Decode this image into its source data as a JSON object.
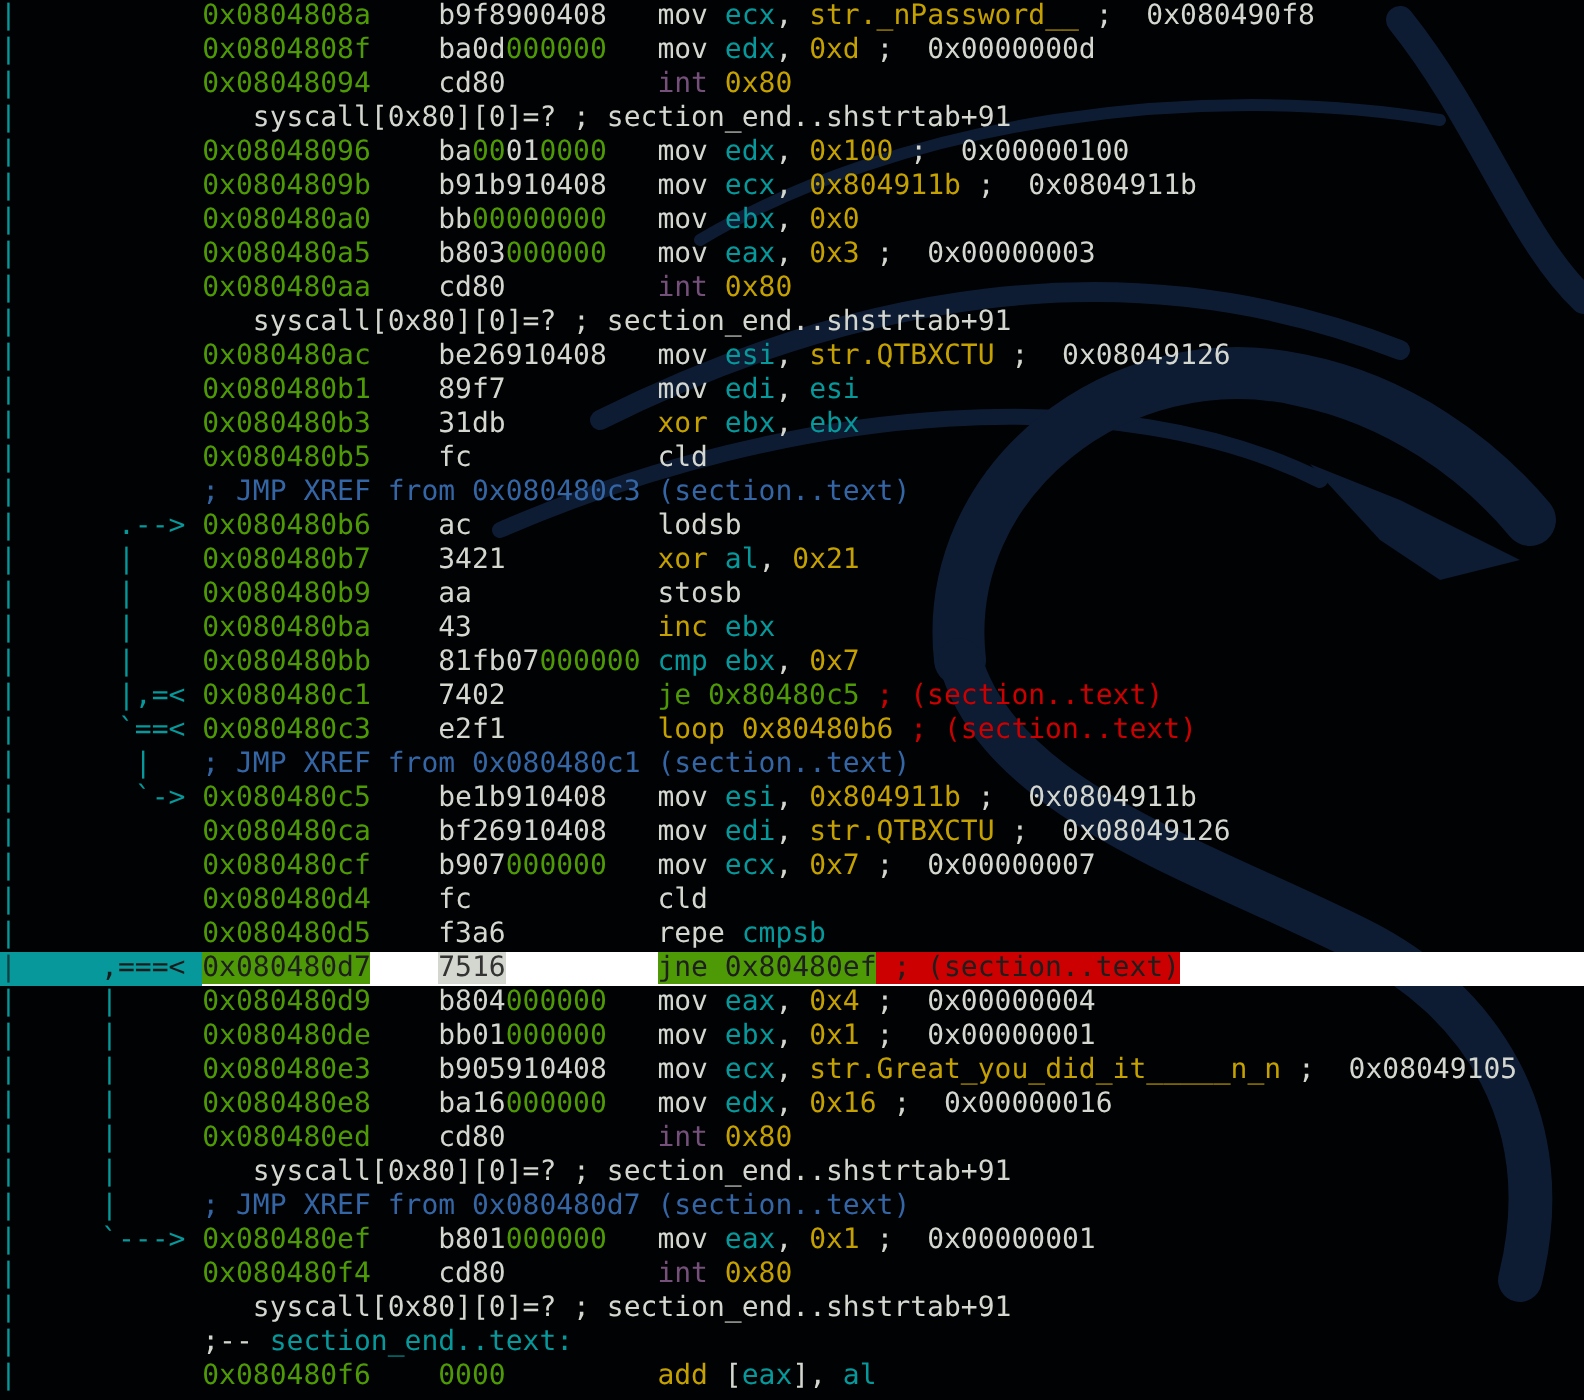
{
  "lines": [
    {
      "kind": "instr",
      "gutter": "|",
      "selected": false,
      "address": "0x0804808a",
      "bytes": [
        {
          "text": "b9f8900408",
          "kind": "hex"
        }
      ],
      "tokens": [
        {
          "text": "mov",
          "kind": "mn"
        },
        {
          "text": " ecx",
          "kind": "reg"
        },
        {
          "text": ",",
          "kind": "punct"
        },
        {
          "text": " str._nPassword__",
          "kind": "str"
        },
        {
          "text": " ;  0x080490f8",
          "kind": "comment"
        }
      ]
    },
    {
      "kind": "instr",
      "gutter": "|",
      "selected": false,
      "address": "0x0804808f",
      "bytes": [
        {
          "text": "ba0d",
          "kind": "hex"
        },
        {
          "text": "000000",
          "kind": "zero"
        }
      ],
      "tokens": [
        {
          "text": "mov",
          "kind": "mn"
        },
        {
          "text": " edx",
          "kind": "reg"
        },
        {
          "text": ",",
          "kind": "punct"
        },
        {
          "text": " 0xd",
          "kind": "num"
        },
        {
          "text": " ;  0x0000000d",
          "kind": "comment"
        }
      ]
    },
    {
      "kind": "instr",
      "gutter": "|",
      "selected": false,
      "address": "0x08048094",
      "bytes": [
        {
          "text": "cd80",
          "kind": "hex"
        }
      ],
      "tokens": [
        {
          "text": "int",
          "kind": "trap"
        },
        {
          "text": " 0x80",
          "kind": "num"
        }
      ]
    },
    {
      "kind": "syscall",
      "gutter": "|",
      "text": "syscall[0x80][0]=? ; section_end..shstrtab+91"
    },
    {
      "kind": "instr",
      "gutter": "|",
      "selected": false,
      "address": "0x08048096",
      "bytes": [
        {
          "text": "ba",
          "kind": "hex"
        },
        {
          "text": "00",
          "kind": "zero"
        },
        {
          "text": "01",
          "kind": "hex"
        },
        {
          "text": "0000",
          "kind": "zero"
        }
      ],
      "tokens": [
        {
          "text": "mov",
          "kind": "mn"
        },
        {
          "text": " edx",
          "kind": "reg"
        },
        {
          "text": ",",
          "kind": "punct"
        },
        {
          "text": " 0x100",
          "kind": "num"
        },
        {
          "text": " ;  0x00000100",
          "kind": "comment"
        }
      ]
    },
    {
      "kind": "instr",
      "gutter": "|",
      "selected": false,
      "address": "0x0804809b",
      "bytes": [
        {
          "text": "b91b910408",
          "kind": "hex"
        }
      ],
      "tokens": [
        {
          "text": "mov",
          "kind": "mn"
        },
        {
          "text": " ecx",
          "kind": "reg"
        },
        {
          "text": ",",
          "kind": "punct"
        },
        {
          "text": " 0x804911b",
          "kind": "num"
        },
        {
          "text": " ;  0x0804911b",
          "kind": "comment"
        }
      ]
    },
    {
      "kind": "instr",
      "gutter": "|",
      "selected": false,
      "address": "0x080480a0",
      "bytes": [
        {
          "text": "bb",
          "kind": "hex"
        },
        {
          "text": "00000000",
          "kind": "zero"
        }
      ],
      "tokens": [
        {
          "text": "mov",
          "kind": "mn"
        },
        {
          "text": " ebx",
          "kind": "reg"
        },
        {
          "text": ",",
          "kind": "punct"
        },
        {
          "text": " 0x0",
          "kind": "num"
        }
      ]
    },
    {
      "kind": "instr",
      "gutter": "|",
      "selected": false,
      "address": "0x080480a5",
      "bytes": [
        {
          "text": "b803",
          "kind": "hex"
        },
        {
          "text": "000000",
          "kind": "zero"
        }
      ],
      "tokens": [
        {
          "text": "mov",
          "kind": "mn"
        },
        {
          "text": " eax",
          "kind": "reg"
        },
        {
          "text": ",",
          "kind": "punct"
        },
        {
          "text": " 0x3",
          "kind": "num"
        },
        {
          "text": " ;  0x00000003",
          "kind": "comment"
        }
      ]
    },
    {
      "kind": "instr",
      "gutter": "|",
      "selected": false,
      "address": "0x080480aa",
      "bytes": [
        {
          "text": "cd80",
          "kind": "hex"
        }
      ],
      "tokens": [
        {
          "text": "int",
          "kind": "trap"
        },
        {
          "text": " 0x80",
          "kind": "num"
        }
      ]
    },
    {
      "kind": "syscall",
      "gutter": "|",
      "text": "syscall[0x80][0]=? ; section_end..shstrtab+91"
    },
    {
      "kind": "instr",
      "gutter": "|",
      "selected": false,
      "address": "0x080480ac",
      "bytes": [
        {
          "text": "be26910408",
          "kind": "hex"
        }
      ],
      "tokens": [
        {
          "text": "mov",
          "kind": "mn"
        },
        {
          "text": " esi",
          "kind": "reg"
        },
        {
          "text": ",",
          "kind": "punct"
        },
        {
          "text": " str.QTBXCTU",
          "kind": "str"
        },
        {
          "text": " ;  0x08049126",
          "kind": "comment"
        }
      ]
    },
    {
      "kind": "instr",
      "gutter": "|",
      "selected": false,
      "address": "0x080480b1",
      "bytes": [
        {
          "text": "89f7",
          "kind": "hex"
        }
      ],
      "tokens": [
        {
          "text": "mov",
          "kind": "mn"
        },
        {
          "text": " edi",
          "kind": "reg"
        },
        {
          "text": ",",
          "kind": "punct"
        },
        {
          "text": " esi",
          "kind": "reg"
        }
      ]
    },
    {
      "kind": "instr",
      "gutter": "|",
      "selected": false,
      "address": "0x080480b3",
      "bytes": [
        {
          "text": "31db",
          "kind": "hex"
        }
      ],
      "tokens": [
        {
          "text": "xor",
          "kind": "arith"
        },
        {
          "text": " ebx",
          "kind": "reg"
        },
        {
          "text": ",",
          "kind": "punct"
        },
        {
          "text": " ebx",
          "kind": "reg"
        }
      ]
    },
    {
      "kind": "instr",
      "gutter": "|",
      "selected": false,
      "address": "0x080480b5",
      "bytes": [
        {
          "text": "fc",
          "kind": "hex"
        }
      ],
      "tokens": [
        {
          "text": "cld",
          "kind": "mn"
        }
      ]
    },
    {
      "kind": "xref",
      "gutter": "|",
      "text": "; JMP XREF from 0x080480c3 (section..text)"
    },
    {
      "kind": "instr",
      "gutter": "|",
      "selected": false,
      "flow": ".-->",
      "address": "0x080480b6",
      "bytes": [
        {
          "text": "ac",
          "kind": "hex"
        }
      ],
      "tokens": [
        {
          "text": "lodsb",
          "kind": "mn"
        }
      ]
    },
    {
      "kind": "instr",
      "gutter": "|",
      "selected": false,
      "flow": "|   ",
      "address": "0x080480b7",
      "bytes": [
        {
          "text": "3421",
          "kind": "hex"
        }
      ],
      "tokens": [
        {
          "text": "xor",
          "kind": "arith"
        },
        {
          "text": " al",
          "kind": "reg"
        },
        {
          "text": ",",
          "kind": "punct"
        },
        {
          "text": " 0x21",
          "kind": "num"
        }
      ]
    },
    {
      "kind": "instr",
      "gutter": "|",
      "selected": false,
      "flow": "|   ",
      "address": "0x080480b9",
      "bytes": [
        {
          "text": "aa",
          "kind": "hex"
        }
      ],
      "tokens": [
        {
          "text": "stosb",
          "kind": "mn"
        }
      ]
    },
    {
      "kind": "instr",
      "gutter": "|",
      "selected": false,
      "flow": "|   ",
      "address": "0x080480ba",
      "bytes": [
        {
          "text": "43",
          "kind": "hex"
        }
      ],
      "tokens": [
        {
          "text": "inc",
          "kind": "arith"
        },
        {
          "text": " ebx",
          "kind": "reg"
        }
      ]
    },
    {
      "kind": "instr",
      "gutter": "|",
      "selected": false,
      "flow": "|   ",
      "address": "0x080480bb",
      "bytes": [
        {
          "text": "81fb07",
          "kind": "hex"
        },
        {
          "text": "000000",
          "kind": "zero"
        }
      ],
      "tokens": [
        {
          "text": "cmp",
          "kind": "cmp"
        },
        {
          "text": " ebx",
          "kind": "reg"
        },
        {
          "text": ",",
          "kind": "punct"
        },
        {
          "text": " 0x7",
          "kind": "num"
        }
      ]
    },
    {
      "kind": "instr",
      "gutter": "|",
      "selected": false,
      "flow": "|,=<",
      "address": "0x080480c1",
      "bytes": [
        {
          "text": "7402",
          "kind": "hex"
        }
      ],
      "tokens": [
        {
          "text": "je 0x80480c5",
          "kind": "jump"
        },
        {
          "text": " ; (section..text)",
          "kind": "ref"
        }
      ]
    },
    {
      "kind": "instr",
      "gutter": "|",
      "selected": false,
      "flow": "`==<",
      "address": "0x080480c3",
      "bytes": [
        {
          "text": "e2f1",
          "kind": "hex"
        }
      ],
      "tokens": [
        {
          "text": "loop",
          "kind": "arith"
        },
        {
          "text": " 0x80480b6",
          "kind": "num"
        },
        {
          "text": " ; (section..text)",
          "kind": "ref"
        }
      ]
    },
    {
      "kind": "xref",
      "gutter": "|",
      "flow": "|  ",
      "text": "; JMP XREF from 0x080480c1 (section..text)"
    },
    {
      "kind": "instr",
      "gutter": "|",
      "selected": false,
      "flow": "`->",
      "address": "0x080480c5",
      "bytes": [
        {
          "text": "be1b910408",
          "kind": "hex"
        }
      ],
      "tokens": [
        {
          "text": "mov",
          "kind": "mn"
        },
        {
          "text": " esi",
          "kind": "reg"
        },
        {
          "text": ",",
          "kind": "punct"
        },
        {
          "text": " 0x804911b",
          "kind": "num"
        },
        {
          "text": " ;  0x0804911b",
          "kind": "comment"
        }
      ]
    },
    {
      "kind": "instr",
      "gutter": "|",
      "selected": false,
      "address": "0x080480ca",
      "bytes": [
        {
          "text": "bf26910408",
          "kind": "hex"
        }
      ],
      "tokens": [
        {
          "text": "mov",
          "kind": "mn"
        },
        {
          "text": " edi",
          "kind": "reg"
        },
        {
          "text": ",",
          "kind": "punct"
        },
        {
          "text": " str.QTBXCTU",
          "kind": "str"
        },
        {
          "text": " ;  0x08049126",
          "kind": "comment"
        }
      ]
    },
    {
      "kind": "instr",
      "gutter": "|",
      "selected": false,
      "address": "0x080480cf",
      "bytes": [
        {
          "text": "b907",
          "kind": "hex"
        },
        {
          "text": "000000",
          "kind": "zero"
        }
      ],
      "tokens": [
        {
          "text": "mov",
          "kind": "mn"
        },
        {
          "text": " ecx",
          "kind": "reg"
        },
        {
          "text": ",",
          "kind": "punct"
        },
        {
          "text": " 0x7",
          "kind": "num"
        },
        {
          "text": " ;  0x00000007",
          "kind": "comment"
        }
      ]
    },
    {
      "kind": "instr",
      "gutter": "|",
      "selected": false,
      "address": "0x080480d4",
      "bytes": [
        {
          "text": "fc",
          "kind": "hex"
        }
      ],
      "tokens": [
        {
          "text": "cld",
          "kind": "mn"
        }
      ]
    },
    {
      "kind": "instr",
      "gutter": "|",
      "selected": false,
      "address": "0x080480d5",
      "bytes": [
        {
          "text": "f3a6",
          "kind": "hex"
        }
      ],
      "tokens": [
        {
          "text": "repe",
          "kind": "mn"
        },
        {
          "text": " cmpsb",
          "kind": "cmp"
        }
      ]
    },
    {
      "kind": "instr",
      "gutter": "|",
      "selected": true,
      "flow": ",===<",
      "address": "0x080480d7",
      "bytes": [
        {
          "text": "7516",
          "kind": "hex"
        }
      ],
      "tokens": [
        {
          "text": "jne 0x80480ef",
          "kind": "jump"
        },
        {
          "text": " ; (section..text)",
          "kind": "ref"
        }
      ]
    },
    {
      "kind": "instr",
      "gutter": "|",
      "selected": false,
      "flow": "|    ",
      "address": "0x080480d9",
      "bytes": [
        {
          "text": "b804",
          "kind": "hex"
        },
        {
          "text": "000000",
          "kind": "zero"
        }
      ],
      "tokens": [
        {
          "text": "mov",
          "kind": "mn"
        },
        {
          "text": " eax",
          "kind": "reg"
        },
        {
          "text": ",",
          "kind": "punct"
        },
        {
          "text": " 0x4",
          "kind": "num"
        },
        {
          "text": " ;  0x00000004",
          "kind": "comment"
        }
      ]
    },
    {
      "kind": "instr",
      "gutter": "|",
      "selected": false,
      "flow": "|    ",
      "address": "0x080480de",
      "bytes": [
        {
          "text": "bb01",
          "kind": "hex"
        },
        {
          "text": "000000",
          "kind": "zero"
        }
      ],
      "tokens": [
        {
          "text": "mov",
          "kind": "mn"
        },
        {
          "text": " ebx",
          "kind": "reg"
        },
        {
          "text": ",",
          "kind": "punct"
        },
        {
          "text": " 0x1",
          "kind": "num"
        },
        {
          "text": " ;  0x00000001",
          "kind": "comment"
        }
      ]
    },
    {
      "kind": "instr",
      "gutter": "|",
      "selected": false,
      "flow": "|    ",
      "address": "0x080480e3",
      "bytes": [
        {
          "text": "b905910408",
          "kind": "hex"
        }
      ],
      "tokens": [
        {
          "text": "mov",
          "kind": "mn"
        },
        {
          "text": " ecx",
          "kind": "reg"
        },
        {
          "text": ",",
          "kind": "punct"
        },
        {
          "text": " str.Great_you_did_it_____n_n",
          "kind": "str"
        },
        {
          "text": " ;  0x08049105",
          "kind": "comment"
        }
      ]
    },
    {
      "kind": "instr",
      "gutter": "|",
      "selected": false,
      "flow": "|    ",
      "address": "0x080480e8",
      "bytes": [
        {
          "text": "ba16",
          "kind": "hex"
        },
        {
          "text": "000000",
          "kind": "zero"
        }
      ],
      "tokens": [
        {
          "text": "mov",
          "kind": "mn"
        },
        {
          "text": " edx",
          "kind": "reg"
        },
        {
          "text": ",",
          "kind": "punct"
        },
        {
          "text": " 0x16",
          "kind": "num"
        },
        {
          "text": " ;  0x00000016",
          "kind": "comment"
        }
      ]
    },
    {
      "kind": "instr",
      "gutter": "|",
      "selected": false,
      "flow": "|    ",
      "address": "0x080480ed",
      "bytes": [
        {
          "text": "cd80",
          "kind": "hex"
        }
      ],
      "tokens": [
        {
          "text": "int",
          "kind": "trap"
        },
        {
          "text": " 0x80",
          "kind": "num"
        }
      ]
    },
    {
      "kind": "syscall",
      "gutter": "|",
      "flow": "|    ",
      "text": "syscall[0x80][0]=? ; section_end..shstrtab+91"
    },
    {
      "kind": "xref",
      "gutter": "|",
      "flow": "|    ",
      "text": "; JMP XREF from 0x080480d7 (section..text)"
    },
    {
      "kind": "instr",
      "gutter": "|",
      "selected": false,
      "flow": "`--->",
      "address": "0x080480ef",
      "bytes": [
        {
          "text": "b801",
          "kind": "hex"
        },
        {
          "text": "000000",
          "kind": "zero"
        }
      ],
      "tokens": [
        {
          "text": "mov",
          "kind": "mn"
        },
        {
          "text": " eax",
          "kind": "reg"
        },
        {
          "text": ",",
          "kind": "punct"
        },
        {
          "text": " 0x1",
          "kind": "num"
        },
        {
          "text": " ;  0x00000001",
          "kind": "comment"
        }
      ]
    },
    {
      "kind": "instr",
      "gutter": "|",
      "selected": false,
      "address": "0x080480f4",
      "bytes": [
        {
          "text": "cd80",
          "kind": "hex"
        }
      ],
      "tokens": [
        {
          "text": "int",
          "kind": "trap"
        },
        {
          "text": " 0x80",
          "kind": "num"
        }
      ]
    },
    {
      "kind": "syscall",
      "gutter": "|",
      "text": "syscall[0x80][0]=? ; section_end..shstrtab+91"
    },
    {
      "kind": "label",
      "gutter": "|",
      "tokens": [
        {
          "text": ";-- ",
          "kind": "mn"
        },
        {
          "text": "section_end..text:",
          "kind": "reg"
        }
      ]
    },
    {
      "kind": "instr",
      "gutter": "|",
      "selected": false,
      "address": "0x080480f6",
      "bytes": [
        {
          "text": "0000",
          "kind": "zero"
        }
      ],
      "tokens": [
        {
          "text": "add",
          "kind": "arith"
        },
        {
          "text": " [",
          "kind": "punct"
        },
        {
          "text": "eax",
          "kind": "reg"
        },
        {
          "text": "],",
          "kind": "punct"
        },
        {
          "text": " al",
          "kind": "reg"
        }
      ]
    }
  ]
}
